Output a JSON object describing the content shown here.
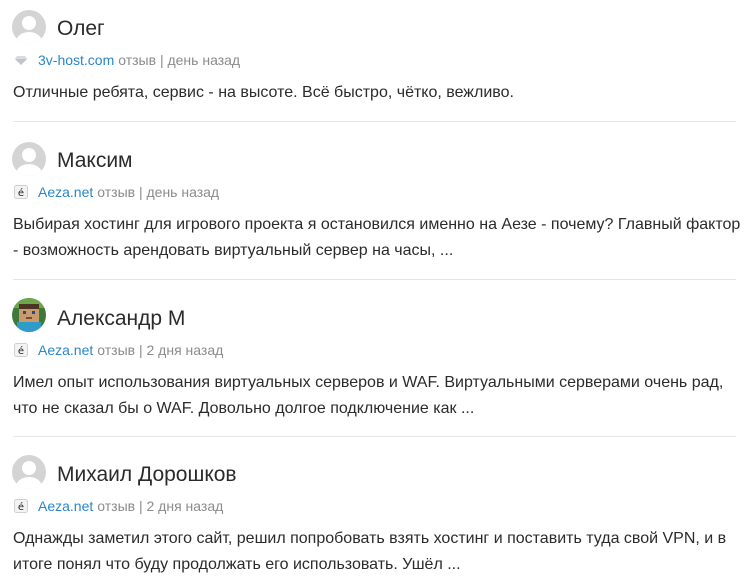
{
  "reviews": [
    {
      "author": "Олег",
      "site": "3v-host.com",
      "meta": "отзыв | день назад",
      "text": "Отличные ребята, сервис - на высоте. Всё быстро, чётко, вежливо.",
      "avatar_icon": "default-user-avatar",
      "site_icon": "diamond-icon"
    },
    {
      "author": "Максим",
      "site": "Aeza.net",
      "meta": "отзыв | день назад",
      "text": "Выбирая хостинг для игрового проекта я остановился именно на Аезе - почему? Главный фактор - возможность арендовать виртуальный сервер на часы, ...",
      "avatar_icon": "default-user-avatar",
      "site_icon": "aeza-logo-icon"
    },
    {
      "author": "Александр М",
      "site": "Aeza.net",
      "meta": "отзыв | 2 дня назад",
      "text": "Имел опыт использования виртуальных серверов и WAF. Виртуальными серверами очень рад, что не сказал бы о WAF. Довольно долгое подключение как ...",
      "avatar_icon": "pixel-character-avatar",
      "site_icon": "aeza-logo-icon"
    },
    {
      "author": "Михаил Дорошков",
      "site": "Aeza.net",
      "meta": "отзыв | 2 дня назад",
      "text": "Однажды заметил этого сайт, решил попробовать взять хостинг и поставить туда свой VPN, и в итоге понял что буду продолжать его использовать. Ушёл ...",
      "avatar_icon": "default-user-avatar",
      "site_icon": "aeza-logo-icon"
    }
  ],
  "colors": {
    "link": "#2a87c9",
    "meta": "#8b8b8b",
    "text": "#2b2b2b",
    "divider": "#e6e6e6"
  }
}
